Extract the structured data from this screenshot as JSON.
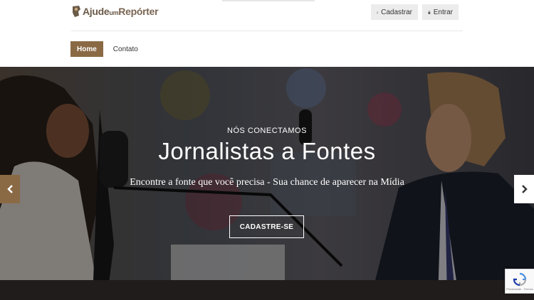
{
  "brand": {
    "part1": "Ajude",
    "part2": "um",
    "part3": "Repórter"
  },
  "header": {
    "cadastrar_label": "Cadastrar",
    "entrar_label": "Entrar"
  },
  "nav": {
    "items": [
      {
        "label": "Home",
        "active": true
      },
      {
        "label": "Contato",
        "active": false
      }
    ]
  },
  "hero": {
    "kicker": "NÓS CONECTAMOS",
    "title": "Jornalistas a Fontes",
    "subtitle": "Encontre a fonte que você precisa - Sua chance de aparecer na Mídia",
    "cta_label": "CADASTRE-SE"
  },
  "recaptcha": {
    "footer": "Privacidade - Termos"
  },
  "colors": {
    "accent": "#8a6a45",
    "brand_text": "#6b5a48"
  }
}
